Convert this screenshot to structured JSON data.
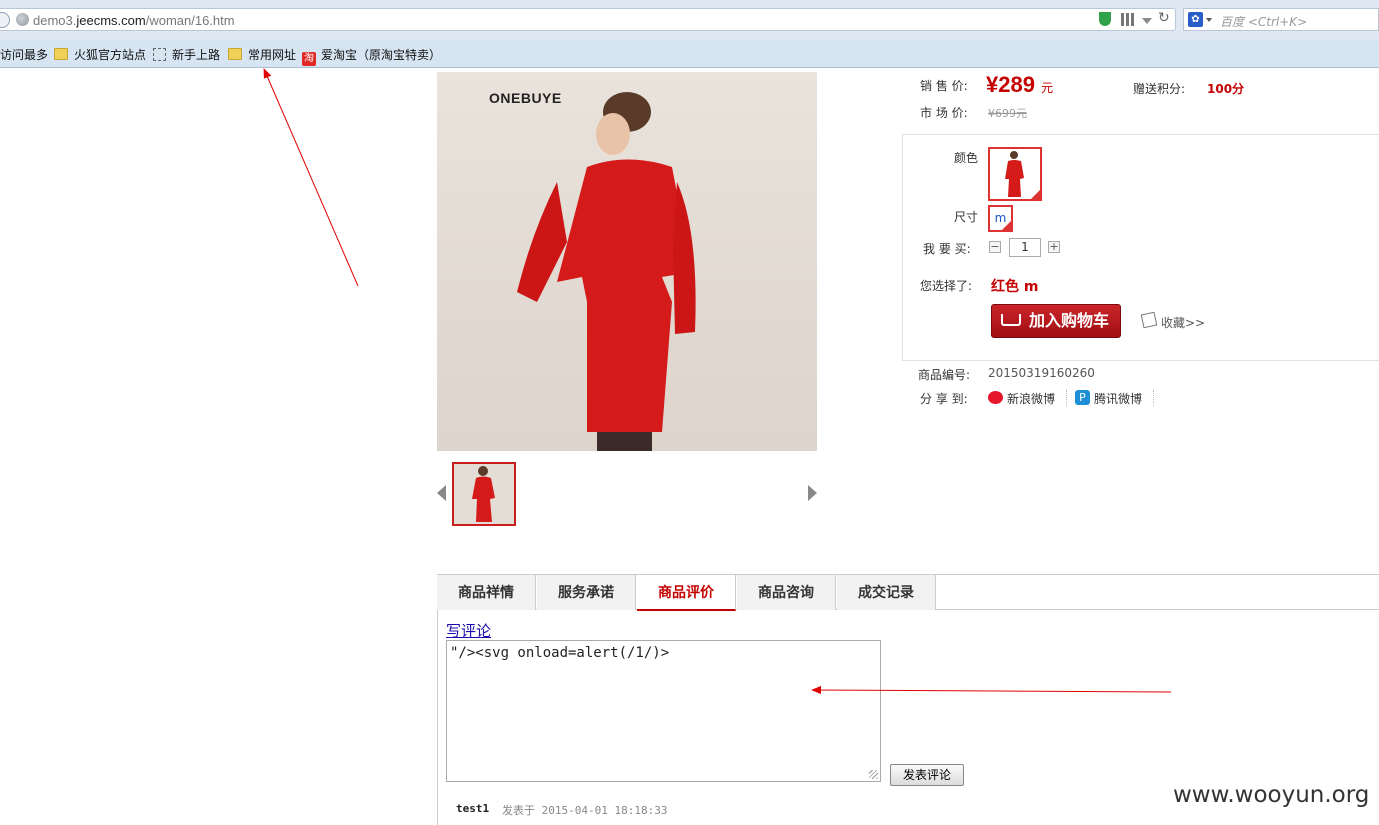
{
  "browser": {
    "url_prefix": "demo3.",
    "url_domain": "jeecms.com",
    "url_path": "/woman/16.htm",
    "search_placeholder": "百度 <Ctrl+K>",
    "bookmarks": [
      "访问最多",
      "火狐官方站点",
      "新手上路",
      "常用网址",
      "爱淘宝（原淘宝特卖）"
    ],
    "taobao_glyph": "淘"
  },
  "product": {
    "brand_logo": "ONEBUYE",
    "sale_price_label": "销 售 价:",
    "sale_price": "¥289",
    "sale_price_unit": "元",
    "points_label": "赠送积分:",
    "points_value": "100分",
    "market_price_label": "市 场 价:",
    "market_price": "¥699元",
    "color_label": "颜色",
    "size_label": "尺寸",
    "size_value": "m",
    "buy_label": "我 要 买:",
    "quantity": "1",
    "minus": "−",
    "plus": "+",
    "selected_label": "您选择了:",
    "selected_value": "红色 m",
    "add_to_cart": "加入购物车",
    "favorite": "收藏>>",
    "product_no_label": "商品编号:",
    "product_no": "20150319160260",
    "share_label": "分 享 到:",
    "share_sina": "新浪微博",
    "share_tencent": "腾讯微博"
  },
  "tabs": [
    {
      "label": "商品祥情",
      "active": false
    },
    {
      "label": "服务承诺",
      "active": false
    },
    {
      "label": "商品评价",
      "active": true
    },
    {
      "label": "商品咨询",
      "active": false
    },
    {
      "label": "成交记录",
      "active": false
    }
  ],
  "comment": {
    "write_link": "写评论",
    "textarea_value": "\"/><svg onload=alert(/1/)>",
    "submit": "发表评论",
    "user": "test1",
    "time": "发表于 2015-04-01 18:18:33"
  },
  "watermark": "www.wooyun.org",
  "colors": {
    "accent": "#c40000",
    "annotation_arrow": "#e00000"
  }
}
